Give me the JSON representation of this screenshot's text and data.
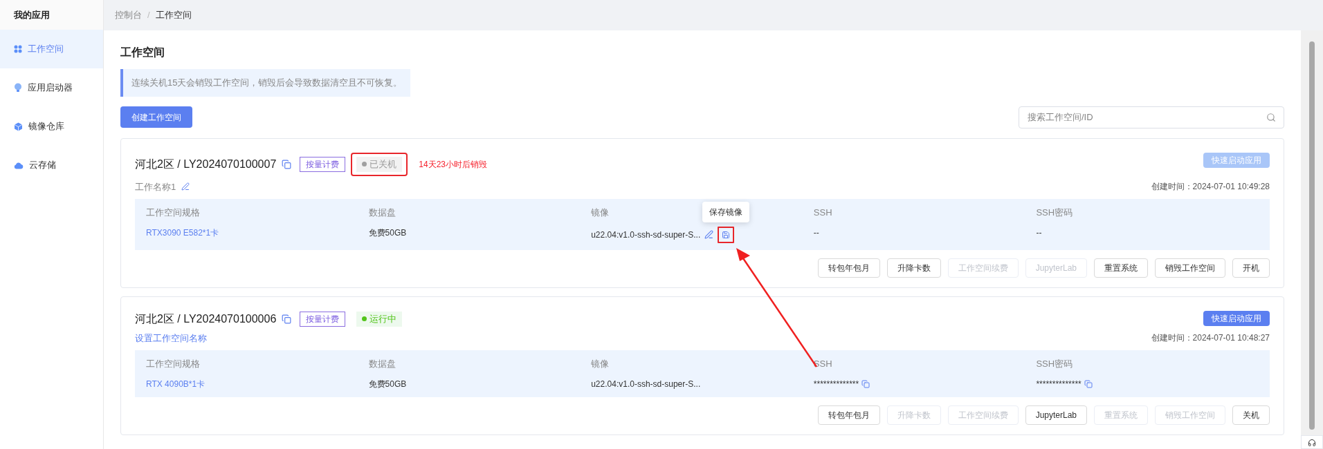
{
  "sidebar": {
    "title": "我的应用",
    "items": [
      {
        "label": "工作空间",
        "selected": true
      },
      {
        "label": "应用启动器",
        "selected": false
      },
      {
        "label": "镜像仓库",
        "selected": false
      },
      {
        "label": "云存储",
        "selected": false
      }
    ]
  },
  "breadcrumb": [
    "控制台",
    "工作空间"
  ],
  "breadcrumb_separator": "/",
  "page_title": "工作空间",
  "notice": "连续关机15天会销毁工作空间，销毁后会导致数据清空且不可恢复。",
  "create_button": "创建工作空间",
  "search": {
    "placeholder": "搜索工作空间/ID"
  },
  "workspaces": [
    {
      "title": "河北2区 / LY2024070100007",
      "billing": "按量计费",
      "status": {
        "label": "已关机",
        "kind": "off",
        "highlighted": true
      },
      "countdown": "14天23小时后销毁",
      "name": {
        "text": "工作名称1",
        "kind": "named"
      },
      "quick_launch": {
        "label": "快速启动应用",
        "disabled": true
      },
      "created": "创建时间：2024-07-01 10:49:28",
      "specs": [
        {
          "label": "工作空间规格",
          "value": "RTX3090 E582*1卡",
          "kind": "link"
        },
        {
          "label": "数据盘",
          "value": "免费50GB",
          "kind": "text"
        },
        {
          "label": "镜像",
          "value": "u22.04:v1.0-ssh-sd-super-S...",
          "kind": "image",
          "actions": true,
          "save_highlighted": true,
          "tooltip": "保存镜像"
        },
        {
          "label": "SSH",
          "value": "--",
          "kind": "text"
        },
        {
          "label": "SSH密码",
          "value": "--",
          "kind": "text"
        }
      ],
      "buttons": [
        {
          "label": "转包年包月",
          "disabled": false
        },
        {
          "label": "升降卡数",
          "disabled": false
        },
        {
          "label": "工作空间续费",
          "disabled": true
        },
        {
          "label": "JupyterLab",
          "disabled": true
        },
        {
          "label": "重置系统",
          "disabled": false
        },
        {
          "label": "销毁工作空间",
          "disabled": false
        },
        {
          "label": "开机",
          "disabled": false
        }
      ]
    },
    {
      "title": "河北2区 / LY2024070100006",
      "billing": "按量计费",
      "status": {
        "label": "运行中",
        "kind": "running",
        "highlighted": false
      },
      "name": {
        "text": "设置工作空间名称",
        "kind": "link"
      },
      "quick_launch": {
        "label": "快速启动应用",
        "disabled": false
      },
      "created": "创建时间：2024-07-01 10:48:27",
      "specs": [
        {
          "label": "工作空间规格",
          "value": "RTX 4090B*1卡",
          "kind": "link"
        },
        {
          "label": "数据盘",
          "value": "免费50GB",
          "kind": "text"
        },
        {
          "label": "镜像",
          "value": "u22.04:v1.0-ssh-sd-super-S...",
          "kind": "image",
          "actions": false
        },
        {
          "label": "SSH",
          "value": "**************",
          "kind": "secret"
        },
        {
          "label": "SSH密码",
          "value": "**************",
          "kind": "secret"
        }
      ],
      "buttons": [
        {
          "label": "转包年包月",
          "disabled": false
        },
        {
          "label": "升降卡数",
          "disabled": true
        },
        {
          "label": "工作空间续费",
          "disabled": true
        },
        {
          "label": "JupyterLab",
          "disabled": false
        },
        {
          "label": "重置系统",
          "disabled": true
        },
        {
          "label": "销毁工作空间",
          "disabled": true
        },
        {
          "label": "关机",
          "disabled": false
        }
      ]
    }
  ]
}
